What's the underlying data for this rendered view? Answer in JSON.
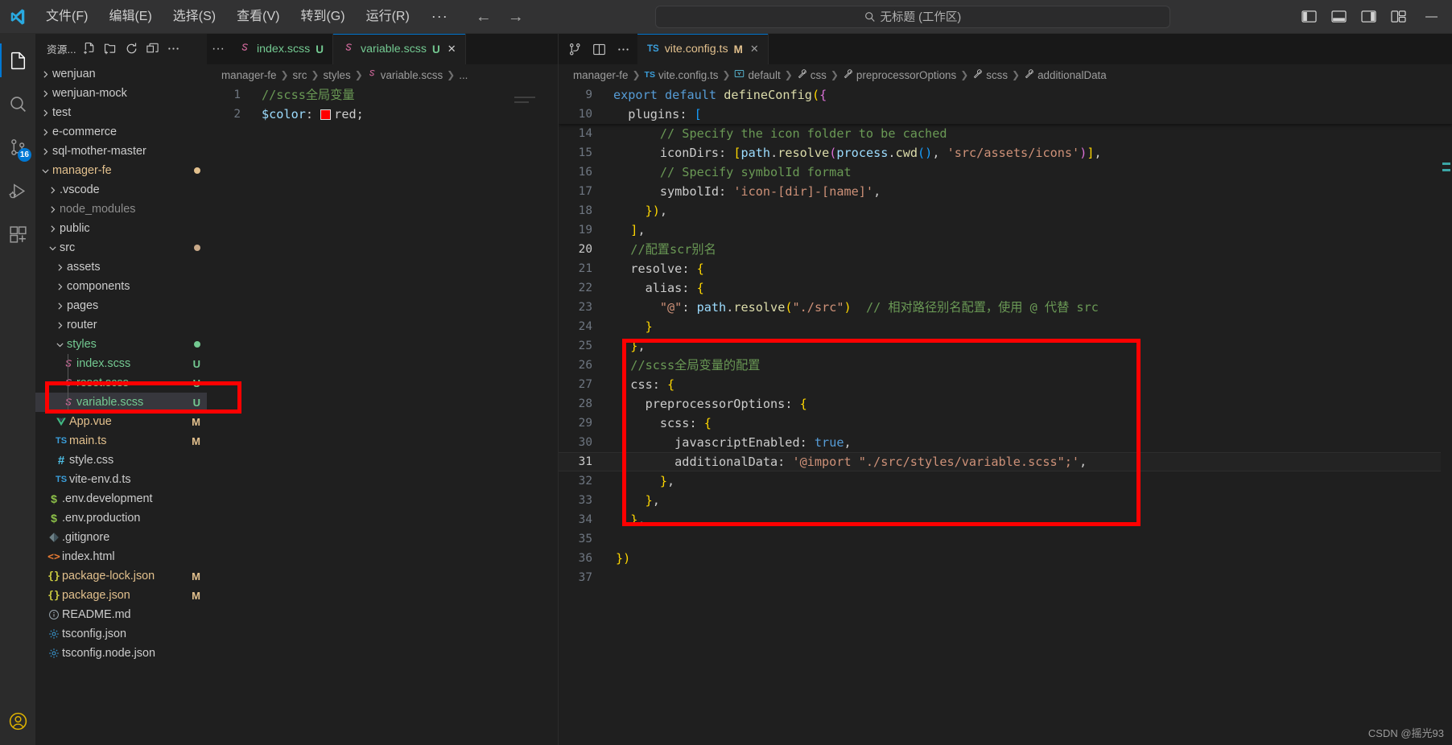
{
  "titlebar": {
    "menu_items": [
      "文件(F)",
      "编辑(E)",
      "选择(S)",
      "查看(V)",
      "转到(G)",
      "运行(R)"
    ],
    "menu_overflow": "···",
    "back_arrow": "←",
    "forward_arrow": "→",
    "quickinput_text": "无标题 (工作区)",
    "minimize": "—"
  },
  "activitybar": {
    "items": [
      {
        "name": "explorer",
        "icon": "files-icon",
        "badge": ""
      },
      {
        "name": "search",
        "icon": "search-icon",
        "badge": ""
      },
      {
        "name": "source-control",
        "icon": "source-control-icon",
        "badge": "16"
      },
      {
        "name": "run-and-debug",
        "icon": "run-debug-icon",
        "badge": ""
      },
      {
        "name": "extensions",
        "icon": "extensions-icon",
        "badge": ""
      }
    ],
    "account_icon": "account-icon"
  },
  "sidebar": {
    "title": "资源...",
    "actions": [
      "new-file-icon",
      "new-folder-icon",
      "refresh-icon",
      "collapse-all-icon",
      "more-actions-icon"
    ],
    "tree": [
      {
        "label": "wenjuan",
        "depth": 0,
        "type": "folder",
        "state": "collapsed",
        "badge": "",
        "dot": "",
        "icon": ""
      },
      {
        "label": "wenjuan-mock",
        "depth": 0,
        "type": "folder",
        "state": "collapsed",
        "badge": "",
        "dot": "",
        "icon": ""
      },
      {
        "label": "test",
        "depth": 0,
        "type": "folder",
        "state": "collapsed",
        "badge": "",
        "dot": "",
        "icon": ""
      },
      {
        "label": "e-commerce",
        "depth": 0,
        "type": "folder",
        "state": "collapsed",
        "badge": "",
        "dot": "",
        "icon": ""
      },
      {
        "label": "sql-mother-master",
        "depth": 0,
        "type": "folder",
        "state": "collapsed",
        "badge": "",
        "dot": "",
        "icon": ""
      },
      {
        "label": "manager-fe",
        "depth": 0,
        "type": "folder",
        "state": "expanded",
        "badge": "",
        "dot": "#e2c08d",
        "icon": "",
        "color": "amber"
      },
      {
        "label": ".vscode",
        "depth": 1,
        "type": "folder",
        "state": "collapsed",
        "badge": "",
        "dot": "",
        "icon": ""
      },
      {
        "label": "node_modules",
        "depth": 1,
        "type": "folder",
        "state": "collapsed",
        "badge": "",
        "dot": "",
        "icon": "",
        "color": "dim"
      },
      {
        "label": "public",
        "depth": 1,
        "type": "folder",
        "state": "collapsed",
        "badge": "",
        "dot": "",
        "icon": ""
      },
      {
        "label": "src",
        "depth": 1,
        "type": "folder",
        "state": "expanded",
        "badge": "",
        "dot": "#c9a989",
        "icon": ""
      },
      {
        "label": "assets",
        "depth": 2,
        "type": "folder",
        "state": "collapsed",
        "badge": "",
        "dot": "",
        "icon": ""
      },
      {
        "label": "components",
        "depth": 2,
        "type": "folder",
        "state": "collapsed",
        "badge": "",
        "dot": "",
        "icon": ""
      },
      {
        "label": "pages",
        "depth": 2,
        "type": "folder",
        "state": "collapsed",
        "badge": "",
        "dot": "",
        "icon": ""
      },
      {
        "label": "router",
        "depth": 2,
        "type": "folder",
        "state": "collapsed",
        "badge": "",
        "dot": "",
        "icon": ""
      },
      {
        "label": "styles",
        "depth": 2,
        "type": "folder",
        "state": "expanded",
        "badge": "",
        "dot": "#73c991",
        "icon": "",
        "color": "green"
      },
      {
        "label": "index.scss",
        "depth": 3,
        "type": "file",
        "state": "",
        "badge": "U",
        "dot": "",
        "icon": "scss-icon",
        "color": "green"
      },
      {
        "label": "reset.scss",
        "depth": 3,
        "type": "file",
        "state": "",
        "badge": "U",
        "dot": "",
        "icon": "scss-icon",
        "color": "green"
      },
      {
        "label": "variable.scss",
        "depth": 3,
        "type": "file",
        "state": "",
        "badge": "U",
        "dot": "",
        "icon": "scss-icon",
        "color": "green",
        "selected": true
      },
      {
        "label": "App.vue",
        "depth": 2,
        "type": "file",
        "state": "",
        "badge": "M",
        "dot": "",
        "icon": "vue-icon",
        "color": "orange"
      },
      {
        "label": "main.ts",
        "depth": 2,
        "type": "file",
        "state": "",
        "badge": "M",
        "dot": "",
        "icon": "ts-icon",
        "color": "orange"
      },
      {
        "label": "style.css",
        "depth": 2,
        "type": "file",
        "state": "",
        "badge": "",
        "dot": "",
        "icon": "css-icon"
      },
      {
        "label": "vite-env.d.ts",
        "depth": 2,
        "type": "file",
        "state": "",
        "badge": "",
        "dot": "",
        "icon": "ts-icon"
      },
      {
        "label": ".env.development",
        "depth": 1,
        "type": "file",
        "state": "",
        "badge": "",
        "dot": "",
        "icon": "env-icon"
      },
      {
        "label": ".env.production",
        "depth": 1,
        "type": "file",
        "state": "",
        "badge": "",
        "dot": "",
        "icon": "env-icon"
      },
      {
        "label": ".gitignore",
        "depth": 1,
        "type": "file",
        "state": "",
        "badge": "",
        "dot": "",
        "icon": "git-icon"
      },
      {
        "label": "index.html",
        "depth": 1,
        "type": "file",
        "state": "",
        "badge": "",
        "dot": "",
        "icon": "html-icon"
      },
      {
        "label": "package-lock.json",
        "depth": 1,
        "type": "file",
        "state": "",
        "badge": "M",
        "dot": "",
        "icon": "json-icon",
        "color": "orange"
      },
      {
        "label": "package.json",
        "depth": 1,
        "type": "file",
        "state": "",
        "badge": "M",
        "dot": "",
        "icon": "json-icon",
        "color": "orange"
      },
      {
        "label": "README.md",
        "depth": 1,
        "type": "file",
        "state": "",
        "badge": "",
        "dot": "",
        "icon": "info-icon"
      },
      {
        "label": "tsconfig.json",
        "depth": 1,
        "type": "file",
        "state": "",
        "badge": "",
        "dot": "",
        "icon": "tsconfig-icon"
      },
      {
        "label": "tsconfig.node.json",
        "depth": 1,
        "type": "file",
        "state": "",
        "badge": "",
        "dot": "",
        "icon": "tsconfig-icon"
      }
    ]
  },
  "editor_left": {
    "tabs": [
      {
        "label": "index.scss",
        "badge": "U",
        "icon": "scss-icon",
        "active": false,
        "closable": false
      },
      {
        "label": "variable.scss",
        "badge": "U",
        "icon": "scss-icon",
        "active": true,
        "closable": true
      }
    ],
    "tab_overflow": "···",
    "breadcrumb": [
      "manager-fe",
      "src",
      "styles",
      "variable.scss",
      "..."
    ],
    "lines": [
      {
        "n": "1",
        "text": "//scss全局变量"
      },
      {
        "n": "2",
        "text": "$color: red;"
      }
    ]
  },
  "editor_right": {
    "actions": [
      "split-editor-icon",
      "split-layout-icon",
      "more-actions-icon"
    ],
    "tabs": [
      {
        "label": "vite.config.ts",
        "badge": "M",
        "icon": "ts-icon",
        "active": true,
        "closable": true
      }
    ],
    "breadcrumb": [
      "manager-fe",
      "vite.config.ts",
      "default",
      "css",
      "preprocessorOptions",
      "scss",
      "additionalData"
    ],
    "sticky_lines": [
      {
        "n": "9",
        "text": "export default defineConfig({"
      },
      {
        "n": "10",
        "text": "  plugins: ["
      }
    ],
    "lines": [
      {
        "n": "14",
        "text": "      // Specify the icon folder to be cached"
      },
      {
        "n": "15",
        "text": "      iconDirs: [path.resolve(process.cwd(), 'src/assets/icons')],"
      },
      {
        "n": "16",
        "text": "      // Specify symbolId format"
      },
      {
        "n": "17",
        "text": "      symbolId: 'icon-[dir]-[name]',"
      },
      {
        "n": "18",
        "text": "    }),"
      },
      {
        "n": "19",
        "text": "  ],"
      },
      {
        "n": "20",
        "text": "  //配置scr别名"
      },
      {
        "n": "21",
        "text": "  resolve: {"
      },
      {
        "n": "22",
        "text": "    alias: {"
      },
      {
        "n": "23",
        "text": "      \"@\": path.resolve(\"./src\")  // 相对路径别名配置，使用 @ 代替 src"
      },
      {
        "n": "24",
        "text": "    }"
      },
      {
        "n": "25",
        "text": "  },"
      },
      {
        "n": "26",
        "text": "  //scss全局变量的配置"
      },
      {
        "n": "27",
        "text": "  css: {"
      },
      {
        "n": "28",
        "text": "    preprocessorOptions: {"
      },
      {
        "n": "29",
        "text": "      scss: {"
      },
      {
        "n": "30",
        "text": "        javascriptEnabled: true,"
      },
      {
        "n": "31",
        "text": "        additionalData: '@import \"./src/styles/variable.scss\";',"
      },
      {
        "n": "32",
        "text": "      },"
      },
      {
        "n": "33",
        "text": "    },"
      },
      {
        "n": "34",
        "text": "  },"
      },
      {
        "n": "35",
        "text": ""
      },
      {
        "n": "36",
        "text": "})"
      },
      {
        "n": "37",
        "text": ""
      }
    ],
    "cursor_line": "20",
    "current_line": "31"
  },
  "annotations": [
    {
      "name": "sidebar-variable-scss-highlight",
      "color": "#ff0000"
    },
    {
      "name": "scss-config-block-highlight",
      "color": "#ff0000"
    }
  ],
  "watermark": "CSDN @摇光93",
  "colors": {
    "accent": "#0078d4",
    "annotation": "#ff0000",
    "added_green": "#73c991",
    "modified_orange": "#e2c08d",
    "comment_green": "#6a9955",
    "string_orange": "#ce9178",
    "keyword_blue": "#569cd6",
    "swatch_red": "#ff0000"
  }
}
